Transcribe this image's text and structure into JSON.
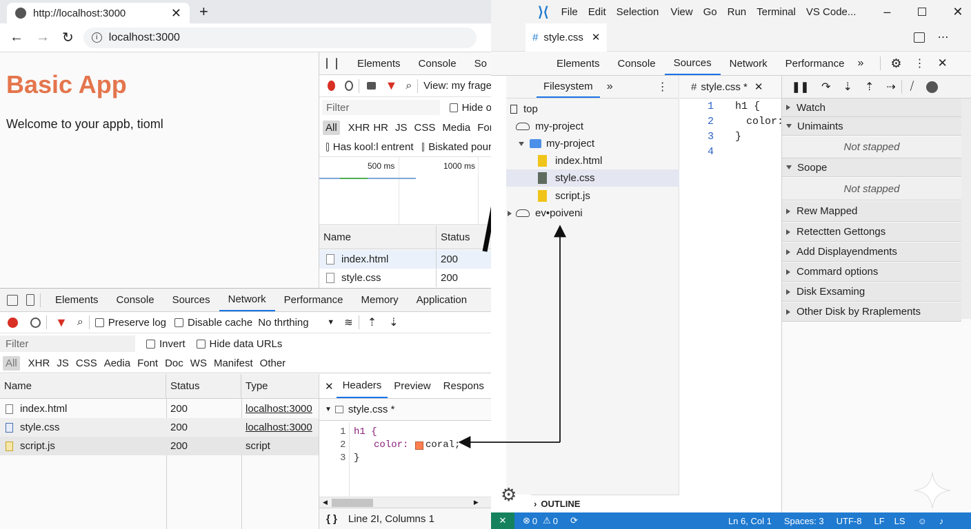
{
  "browser": {
    "tab_title": "http://localhost:3000",
    "address": "localhost:3000"
  },
  "page": {
    "heading": "Basic App",
    "welcome": "Welcome to your appb, tioml"
  },
  "devtools_top": {
    "tabs": [
      "Elements",
      "Console",
      "So"
    ],
    "view_label": "View: my frage",
    "filter_placeholder": "Filter",
    "hide_label": "Hide o",
    "types": [
      "All",
      "XHR",
      "HR",
      "JS",
      "CSS",
      "Media",
      "Font"
    ],
    "has_label": "Has kool:l entrent",
    "blocked_label": "Biskated pour",
    "timeline": [
      "500 ms",
      "1000 ms"
    ],
    "headers": [
      "Name",
      "Status"
    ],
    "rows": [
      {
        "name": "index.html",
        "status": "200"
      },
      {
        "name": "style.css",
        "status": "200"
      }
    ]
  },
  "devtools_bottom": {
    "tabs": [
      "Elements",
      "Console",
      "Sources",
      "Network",
      "Performance",
      "Memory",
      "Application"
    ],
    "preserve_log": "Preserve log",
    "disable_cache": "Disable cache",
    "throttle": "No thrthing",
    "filter_placeholder": "Filter",
    "invert": "Invert",
    "hide_data_urls": "Hide data URLs",
    "types": [
      "All",
      "XHR",
      "JS",
      "CSS",
      "Aedia",
      "Font",
      "Doc",
      "WS",
      "Manifest",
      "Other"
    ],
    "headers": [
      "Name",
      "Status",
      "Type"
    ],
    "rows": [
      {
        "name": "index.html",
        "status": "200",
        "type": "localhost:3000"
      },
      {
        "name": "style.css",
        "status": "200",
        "type": "localhost:3000"
      },
      {
        "name": "script.js",
        "status": "200",
        "type": "script"
      }
    ],
    "detail_tabs": [
      "Headers",
      "Preview",
      "Respons"
    ],
    "detail_file": "style.css *",
    "code": [
      {
        "num": "1",
        "text": "h1 {"
      },
      {
        "num": "2",
        "text": "coral;",
        "prop": "color:"
      },
      {
        "num": "3",
        "text": "}"
      }
    ],
    "status_text": "Line 2I, Columns 1",
    "brace_icon": "{ }"
  },
  "vscode": {
    "menu": [
      "File",
      "Edit",
      "Selection",
      "View",
      "Go",
      "Run",
      "Terminal",
      "VS Code..."
    ],
    "editor_tab": "style.css",
    "panel_tabs": [
      "Elements",
      "Console",
      "Sources",
      "Network",
      "Performance"
    ],
    "fs_tab": "Filesystem",
    "tree": [
      {
        "label": "top",
        "icon": "page"
      },
      {
        "label": "my-project",
        "icon": "cloud"
      },
      {
        "label": "my-project",
        "icon": "folder"
      },
      {
        "label": "index.html",
        "icon": "file-yellow"
      },
      {
        "label": "style.css",
        "icon": "file-gray"
      },
      {
        "label": "script.js",
        "icon": "file-yellow"
      },
      {
        "label": "ev•poiveni",
        "icon": "cloud"
      }
    ],
    "source_tab": "style.css *",
    "line_numbers": [
      "1",
      "2",
      "3",
      "4"
    ],
    "code": [
      "h1 {",
      "color:",
      "}"
    ],
    "sections": [
      {
        "label": "Watch",
        "open": true
      },
      {
        "label": "Unimaints",
        "open": true,
        "body": "Not stapped"
      },
      {
        "label": "Soope",
        "open": true,
        "body": "Not stapped"
      },
      {
        "label": "Rew Mapped",
        "open": false
      },
      {
        "label": "Retectten Gettongs",
        "open": false
      },
      {
        "label": "Add Displayendments",
        "open": false
      },
      {
        "label": "Commard options",
        "open": false
      },
      {
        "label": "Disk Exsaming",
        "open": false
      },
      {
        "label": "Other Disk by Rraplements",
        "open": false
      }
    ],
    "outline": "OUTLINE",
    "status": {
      "errors": "0",
      "warnings": "0",
      "position": "Ln 6, Col 1",
      "spaces": "Spaces: 3",
      "encoding": "UTF-8",
      "eol": "LF",
      "lang": "LS"
    }
  },
  "colors": {
    "accent": "#1a73e8",
    "heading": "#e4754d",
    "statusbar": "#1f7ad0",
    "coral": "#ff7f50"
  }
}
